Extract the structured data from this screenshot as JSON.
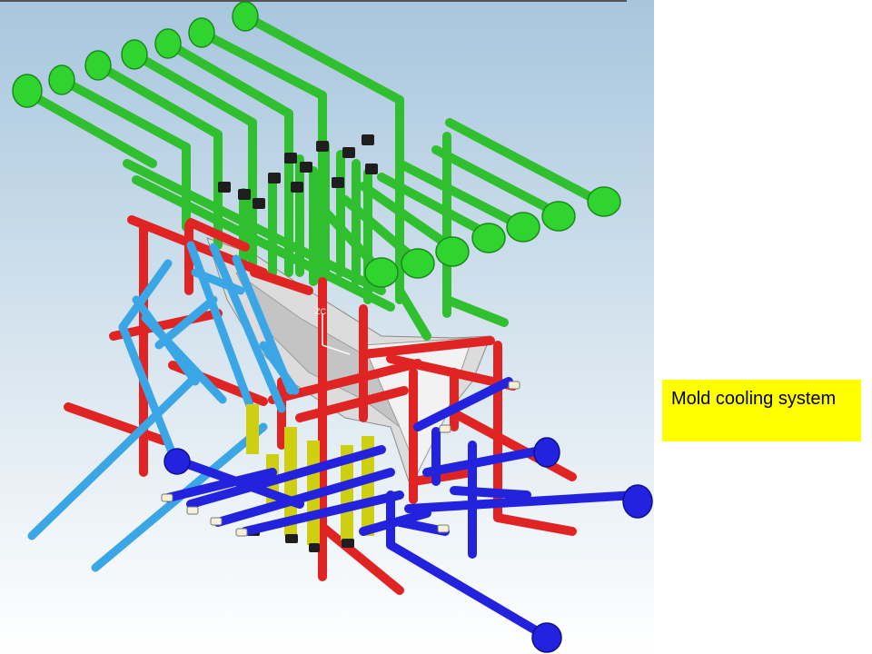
{
  "slide": {
    "caption": "Mold cooling system",
    "caption_background": "#ffff00"
  },
  "render": {
    "axis_label": "ZC",
    "colors": {
      "background_top": "#a7c6de",
      "background_bottom": "#ffffff",
      "green_circuit": "#33cc33",
      "red_circuit": "#e02020",
      "light_blue_circuit": "#3fa9e8",
      "dark_blue_circuit": "#1f1fe0",
      "yellow_baffles": "#d6d61a",
      "mold_part": "#dcdcdc",
      "connector": "#1a1a1a"
    }
  }
}
